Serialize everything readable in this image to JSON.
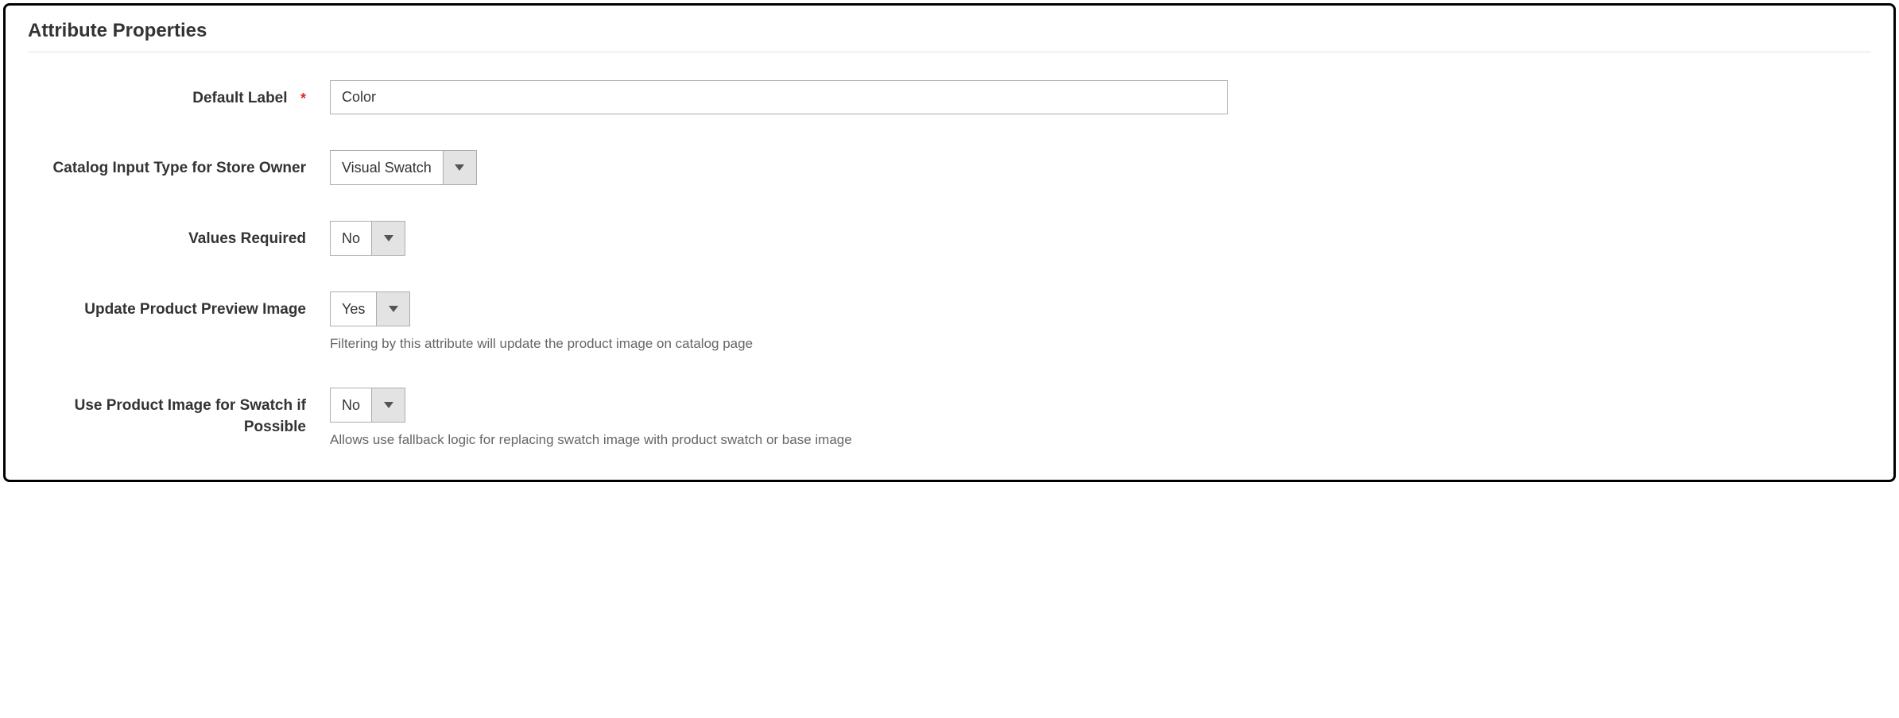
{
  "section": {
    "title": "Attribute Properties"
  },
  "fields": {
    "defaultLabel": {
      "label": "Default Label",
      "value": "Color",
      "required": true
    },
    "catalogInputType": {
      "label": "Catalog Input Type for Store Owner",
      "value": "Visual Swatch"
    },
    "valuesRequired": {
      "label": "Values Required",
      "value": "No"
    },
    "updatePreview": {
      "label": "Update Product Preview Image",
      "value": "Yes",
      "help": "Filtering by this attribute will update the product image on catalog page"
    },
    "useProductImage": {
      "label": "Use Product Image for Swatch if Possible",
      "value": "No",
      "help": "Allows use fallback logic for replacing swatch image with product swatch or base image"
    }
  }
}
